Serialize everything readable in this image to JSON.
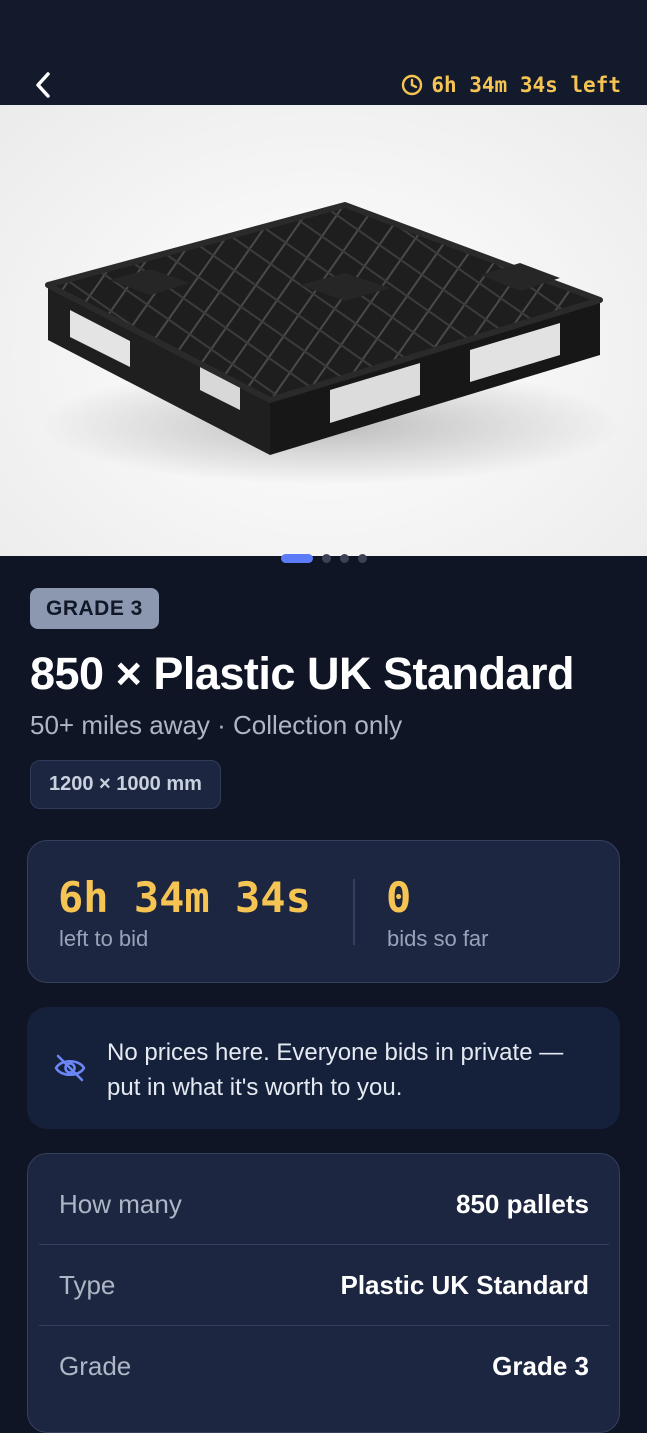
{
  "header": {
    "back_icon": "chevron-left-icon",
    "timer_icon": "clock-icon",
    "timer_text": "6h 34m 34s left",
    "accent_color": "#f6c453"
  },
  "gallery": {
    "image_subject": "black plastic pallet",
    "page_count": 4,
    "active_index": 0
  },
  "listing": {
    "grade_badge": "GRADE 3",
    "title": "850 × Plastic UK Standard",
    "subtitle": "50+ miles away · Collection only",
    "size_chip": "1200 × 1000 mm"
  },
  "stats": {
    "time_value": "6h 34m 34s",
    "time_label": "left to bid",
    "bids_value": "0",
    "bids_label": "bids so far"
  },
  "notice": {
    "icon": "eye-off-icon",
    "text": "No prices here. Everyone bids in private — put in what it's worth to you."
  },
  "details": [
    {
      "label": "How many",
      "value": "850 pallets"
    },
    {
      "label": "Type",
      "value": "Plastic UK Standard"
    },
    {
      "label": "Grade",
      "value": "Grade 3"
    }
  ]
}
